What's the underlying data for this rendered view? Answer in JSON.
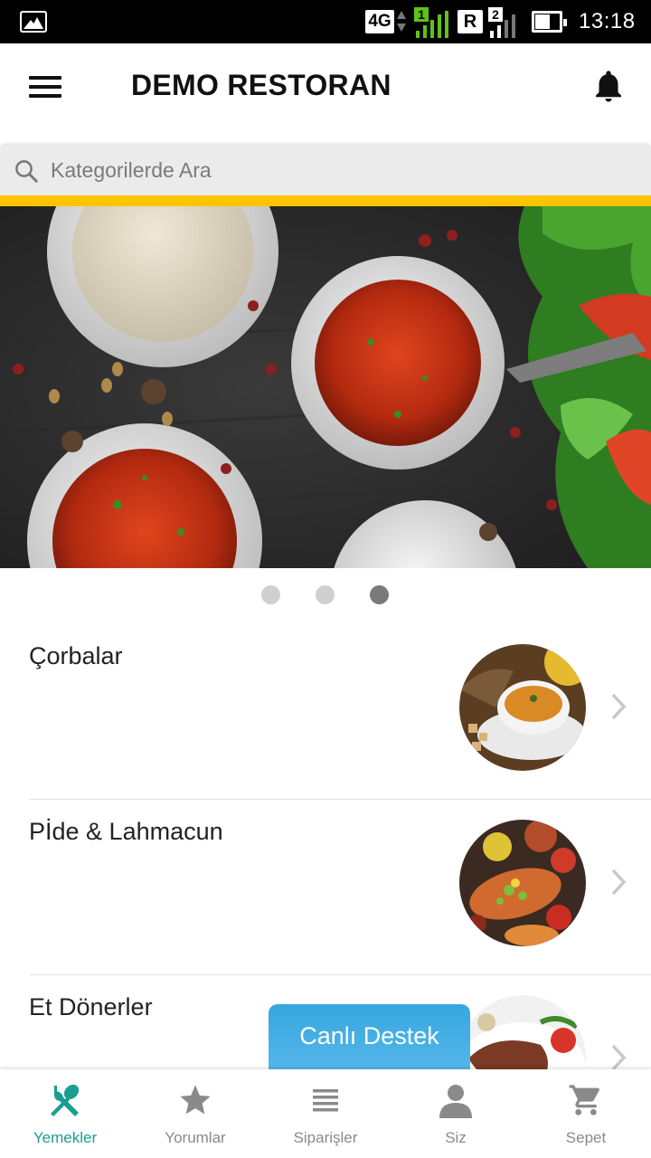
{
  "status_bar": {
    "network_type": "4G",
    "sim1_label": "1",
    "roaming_label": "R",
    "sim2_label": "2",
    "time": "13:18",
    "colors": {
      "sim1": "#5fc21a",
      "sim2": "#ffffff"
    }
  },
  "app_bar": {
    "title": "DEMO RESTORAN",
    "menu_icon": "hamburger-menu-icon",
    "notification_icon": "bell-icon"
  },
  "search": {
    "placeholder": "Kategorilerde Ara",
    "icon": "search-icon"
  },
  "banner": {
    "slide_count": 3,
    "active_slide_index": 2
  },
  "categories": [
    {
      "name": "Çorbalar",
      "image": "soup-bowl-photo"
    },
    {
      "name": "Pİde & Lahmacun",
      "image": "pide-lahmacun-photo"
    },
    {
      "name": "Et Dönerler",
      "image": "doner-plate-photo"
    }
  ],
  "live_support": {
    "label": "Canlı Destek"
  },
  "bottom_nav": {
    "active_index": 0,
    "items": [
      {
        "label": "Yemekler",
        "icon": "fork-spoon-icon"
      },
      {
        "label": "Yorumlar",
        "icon": "star-icon"
      },
      {
        "label": "Siparişler",
        "icon": "list-icon"
      },
      {
        "label": "Siz",
        "icon": "person-icon"
      },
      {
        "label": "Sepet",
        "icon": "cart-icon"
      }
    ]
  },
  "colors": {
    "accent_yellow": "#ffc400",
    "active_tab": "#1a9e8f",
    "inactive_tab": "#8a8a8a",
    "live_support_bg": "#3eaae2"
  }
}
